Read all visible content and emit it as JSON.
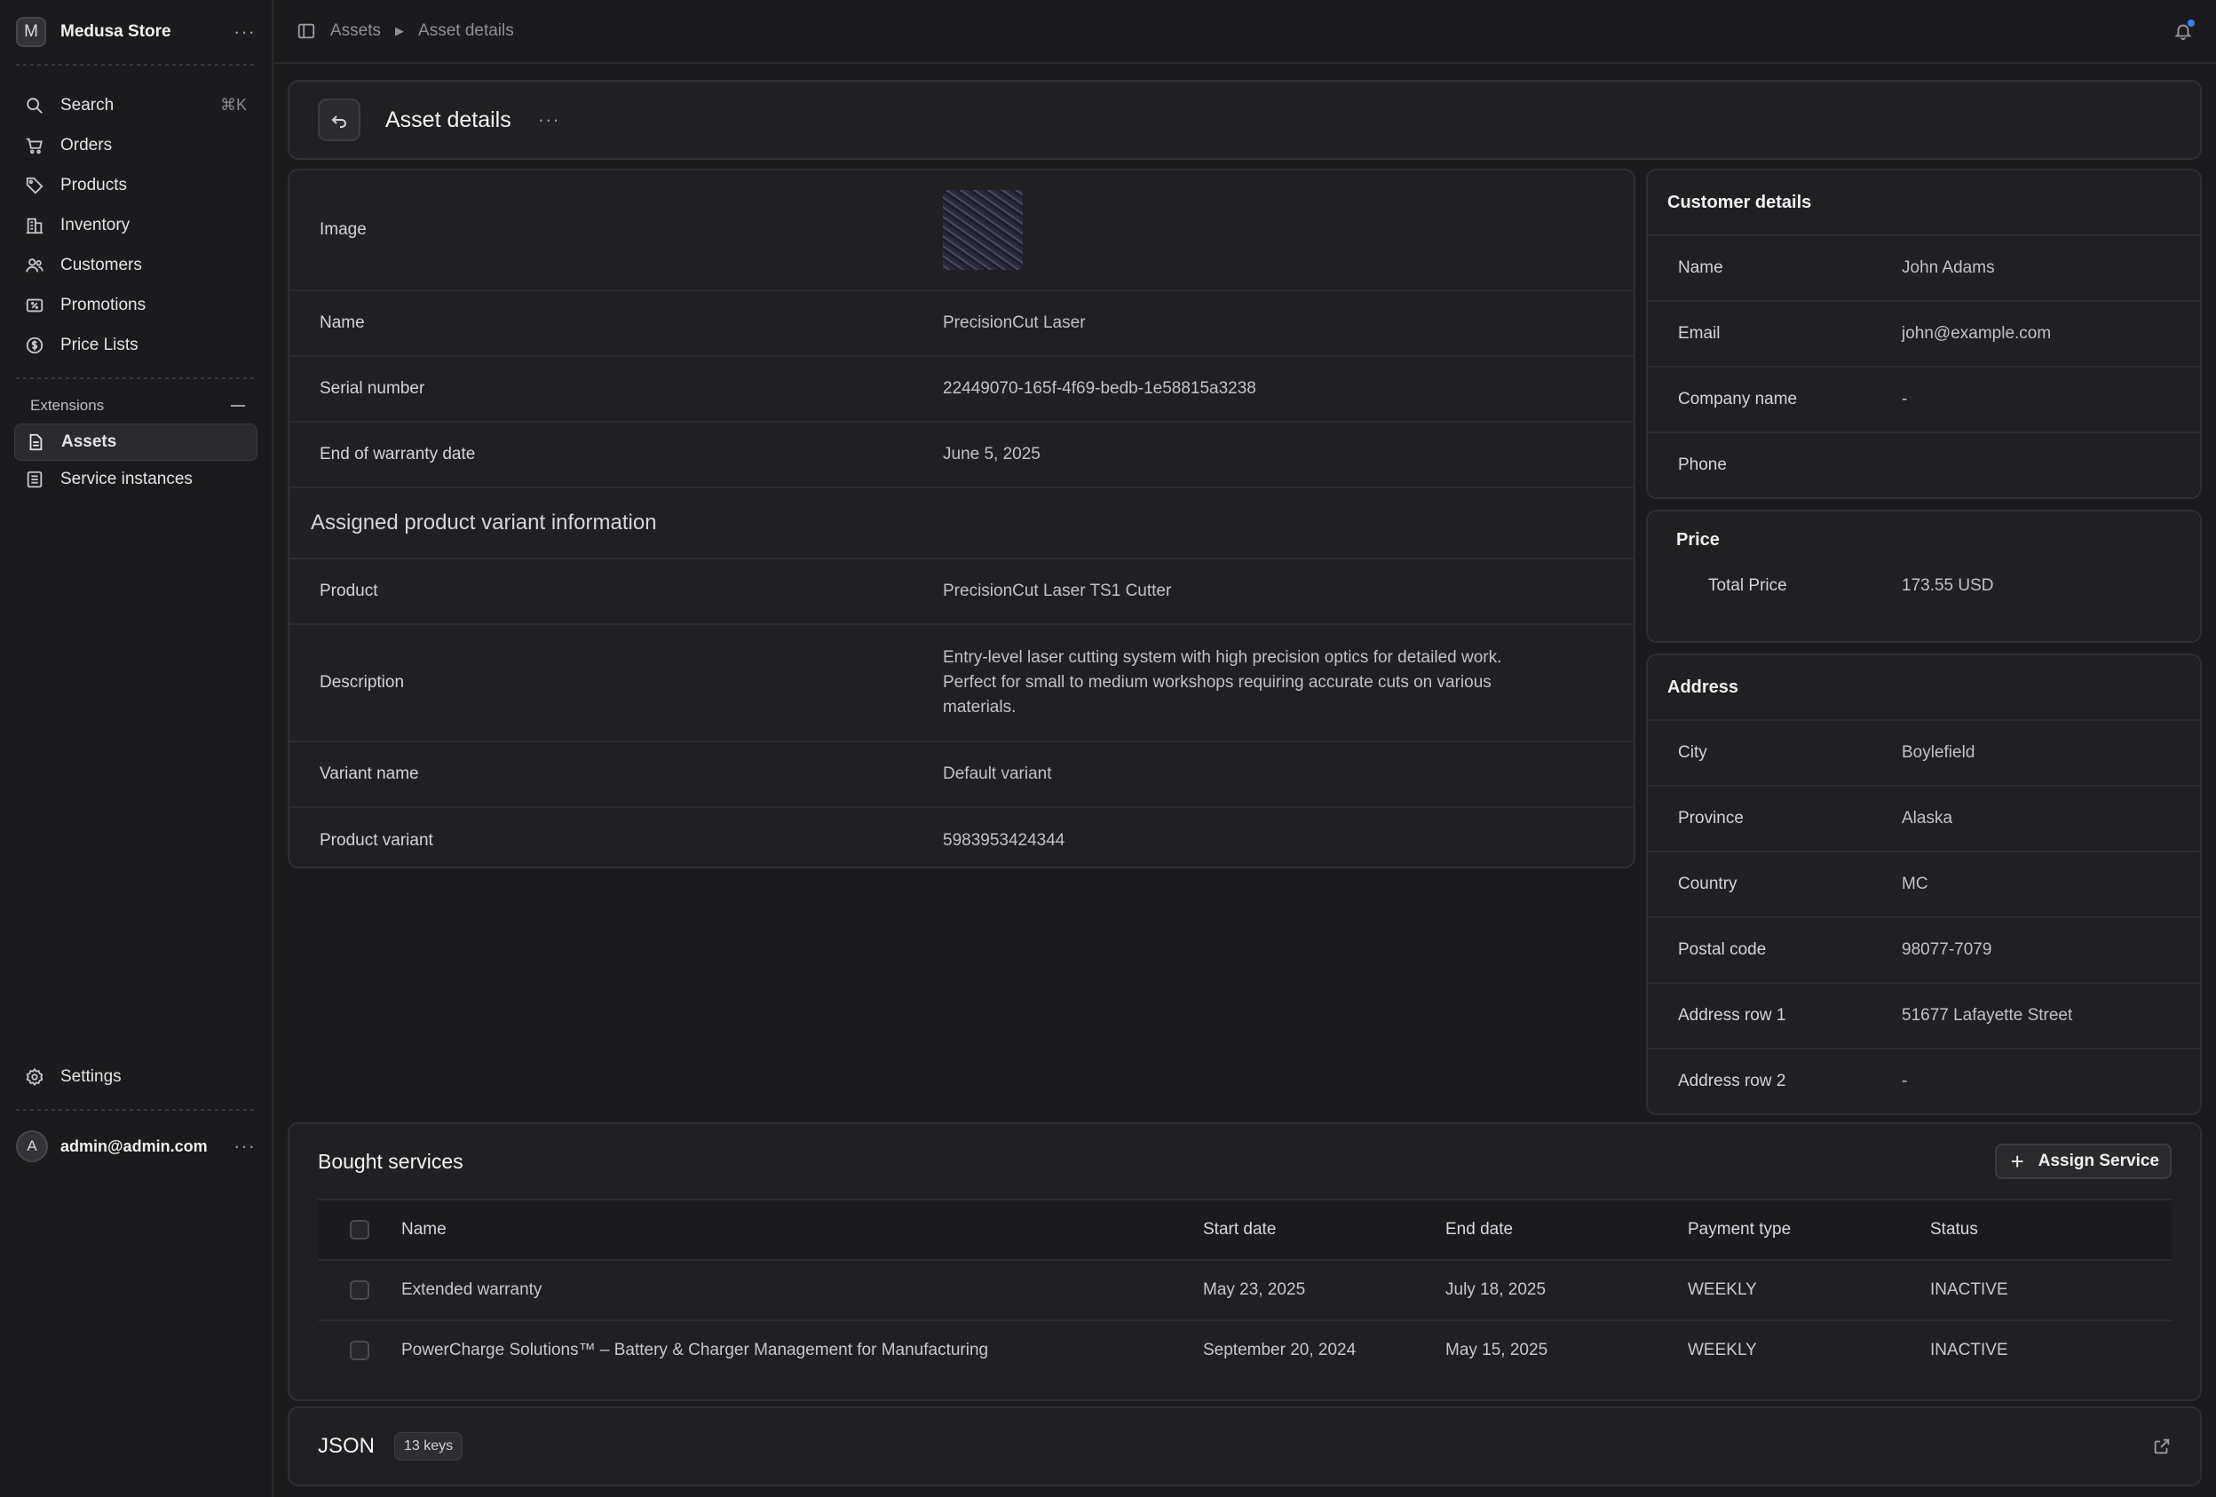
{
  "store": {
    "initial": "M",
    "name": "Medusa Store"
  },
  "nav": {
    "search": "Search",
    "search_shortcut": "⌘K",
    "orders": "Orders",
    "products": "Products",
    "inventory": "Inventory",
    "customers": "Customers",
    "promotions": "Promotions",
    "price_lists": "Price Lists"
  },
  "extensions": {
    "heading": "Extensions",
    "assets": "Assets",
    "service_instances": "Service instances"
  },
  "settings": "Settings",
  "user": {
    "initial": "A",
    "email": "admin@admin.com"
  },
  "breadcrumb": {
    "first": "Assets",
    "second": "Asset details"
  },
  "page": {
    "title": "Asset details"
  },
  "details": {
    "image_label": "Image",
    "name_label": "Name",
    "name_value": "PrecisionCut Laser",
    "serial_label": "Serial number",
    "serial_value": "22449070-165f-4f69-bedb-1e58815a3238",
    "warranty_label": "End of warranty date",
    "warranty_value": "June 5, 2025",
    "variant_section": "Assigned product variant information",
    "product_label": "Product",
    "product_value": "PrecisionCut Laser TS1 Cutter",
    "description_label": "Description",
    "description_value": "Entry-level laser cutting system with high precision optics for detailed work. Perfect for small to medium workshops requiring accurate cuts on various materials.",
    "variant_name_label": "Variant name",
    "variant_name_value": "Default variant",
    "product_variant_label": "Product variant",
    "product_variant_value": "5983953424344"
  },
  "customer": {
    "title": "Customer details",
    "name_label": "Name",
    "name_value": "John Adams",
    "email_label": "Email",
    "email_value": "john@example.com",
    "company_label": "Company name",
    "company_value": "-",
    "phone_label": "Phone",
    "phone_value": ""
  },
  "price": {
    "title": "Price",
    "total_label": "Total Price",
    "total_value": "173.55 USD"
  },
  "address": {
    "title": "Address",
    "city_label": "City",
    "city_value": "Boylefield",
    "province_label": "Province",
    "province_value": "Alaska",
    "country_label": "Country",
    "country_value": "MC",
    "postal_label": "Postal code",
    "postal_value": "98077-7079",
    "row1_label": "Address row 1",
    "row1_value": "51677 Lafayette Street",
    "row2_label": "Address row 2",
    "row2_value": "-"
  },
  "services": {
    "title": "Bought services",
    "assign_label": "Assign Service",
    "columns": {
      "name": "Name",
      "start": "Start date",
      "end": "End date",
      "payment": "Payment type",
      "status": "Status"
    },
    "rows": [
      {
        "name": "Extended warranty",
        "start": "May 23, 2025",
        "end": "July 18, 2025",
        "payment": "WEEKLY",
        "status": "INACTIVE"
      },
      {
        "name": "PowerCharge Solutions™ – Battery & Charger Management for Manufacturing",
        "start": "September 20, 2024",
        "end": "May 15, 2025",
        "payment": "WEEKLY",
        "status": "INACTIVE"
      }
    ]
  },
  "json": {
    "title": "JSON",
    "badge": "13 keys"
  },
  "icons": {
    "search": "search-icon",
    "orders": "cart-icon",
    "products": "tag-icon",
    "inventory": "building-icon",
    "customers": "users-icon",
    "promotions": "receipt-icon",
    "price_lists": "currency-icon",
    "assets": "document-icon",
    "service_instances": "list-icon",
    "settings": "gear-icon",
    "bell": "bell-icon",
    "back": "arrow-back-icon",
    "external": "external-link-icon"
  },
  "colors": {
    "background": "#1b1b1d",
    "card": "#202023",
    "notification_dot": "#3b82f6"
  }
}
